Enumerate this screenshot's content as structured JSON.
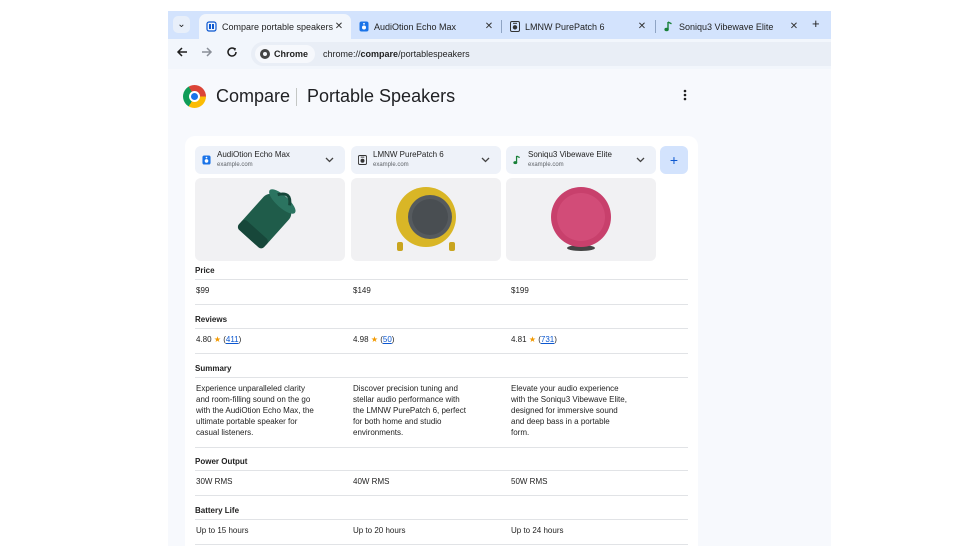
{
  "tabs": [
    {
      "title": "Compare portable speakers",
      "active": true,
      "favicon": "compare-icon"
    },
    {
      "title": "AudiOtion Echo Max",
      "active": false,
      "favicon": "speaker-blue-icon"
    },
    {
      "title": "LMNW PurePatch 6",
      "active": false,
      "favicon": "speaker-dark-icon"
    },
    {
      "title": "Soniqu3 Vibewave Elite",
      "active": false,
      "favicon": "music-note-icon"
    }
  ],
  "toolbar": {
    "site_chip": "Chrome",
    "url_prefix": "chrome://",
    "url_bold": "compare",
    "url_suffix": "/portablespeakers"
  },
  "page": {
    "brand": "Compare",
    "table_title": "Portable Speakers"
  },
  "products": [
    {
      "name": "AudiOtion Echo Max",
      "domain": "example.com",
      "favicon": "speaker-blue-icon"
    },
    {
      "name": "LMNW PurePatch 6",
      "domain": "example.com",
      "favicon": "speaker-dark-icon"
    },
    {
      "name": "Soniqu3 Vibewave Elite",
      "domain": "example.com",
      "favicon": "music-note-icon"
    }
  ],
  "sections": {
    "price": {
      "label": "Price",
      "values": [
        "$99",
        "$149",
        "$199"
      ]
    },
    "reviews": {
      "label": "Reviews",
      "ratings": [
        "4.80",
        "4.98",
        "4.81"
      ],
      "counts": [
        "411",
        "50",
        "731"
      ]
    },
    "summary": {
      "label": "Summary",
      "values": [
        [
          "Experience unparalleled clarity",
          "and room-filling sound on the go",
          "with the AudiOtion Echo Max, the",
          "ultimate portable speaker for",
          "casual listeners."
        ],
        [
          "Discover precision tuning and",
          "stellar audio performance with",
          "the LMNW PurePatch 6, perfect",
          "for both home and studio",
          "environments."
        ],
        [
          "Elevate your audio experience",
          "with the Soniqu3 Vibewave Elite,",
          "designed for immersive sound",
          "and deep bass in a portable",
          "form."
        ]
      ]
    },
    "power": {
      "label": "Power Output",
      "values": [
        "30W RMS",
        "40W RMS",
        "50W RMS"
      ]
    },
    "battery": {
      "label": "Battery Life",
      "values": [
        "Up to 15 hours",
        "Up to 20 hours",
        "Up to 24 hours"
      ]
    }
  },
  "colors": {
    "tabstrip": "#d3e3fd",
    "accent": "#0b57d0",
    "star": "#f29900",
    "speaker_1": "#1f5c4a",
    "speaker_2": "#d9b626",
    "speaker_3": "#c8406c"
  }
}
